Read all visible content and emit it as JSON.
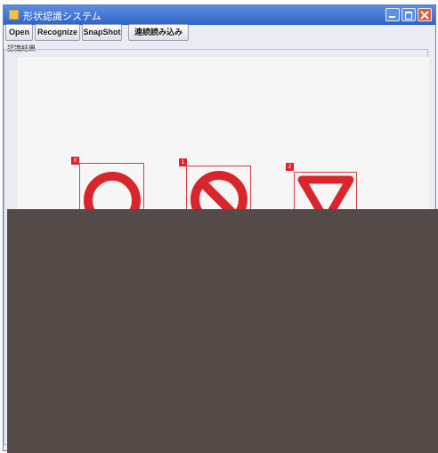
{
  "window": {
    "title": "形状認識システム"
  },
  "toolbar": {
    "open_label": "Open",
    "recognize_label": "Recognize",
    "snapshot_label": "SnapShot",
    "continuous_label": "連続読み込み"
  },
  "panel": {
    "label": "認識結果"
  },
  "detections": [
    {
      "id": "0",
      "shape": "circle"
    },
    {
      "id": "1",
      "shape": "no-entry"
    },
    {
      "id": "2",
      "shape": "triangle"
    }
  ],
  "colors": {
    "sign_red": "#d8262c",
    "titlebar": "#2f63c6",
    "redaction": "#544a47"
  }
}
